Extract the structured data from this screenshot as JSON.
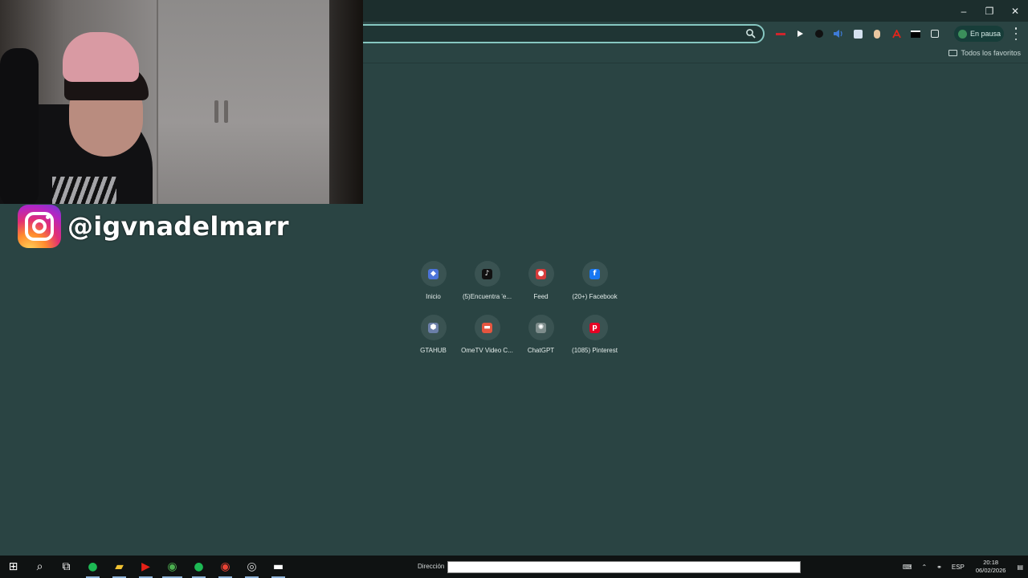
{
  "browser": {
    "window_controls": [
      "–",
      "❐",
      "✕"
    ],
    "extensions": [
      {
        "name": "extension-red-dash",
        "color": "#d0252c"
      },
      {
        "name": "extension-play",
        "color": "#ffffff"
      },
      {
        "name": "extension-dark-circle",
        "color": "#111111"
      },
      {
        "name": "extension-blue-wave",
        "color": "#3e7bd6"
      },
      {
        "name": "extension-translate",
        "color": "#d5e2f0"
      },
      {
        "name": "extension-beige",
        "color": "#e9c6a0"
      },
      {
        "name": "extension-acrobat",
        "color": "#e1251b"
      },
      {
        "name": "extension-badge",
        "color": "#000000"
      },
      {
        "name": "extension-puzzle",
        "color": "#dfe8e7"
      }
    ],
    "profile_status": "En pausa",
    "bookmarks_folder_label": "Todos los favoritos"
  },
  "overlay": {
    "instagram_handle": "@igvnadelmarr"
  },
  "new_tab": {
    "shortcuts": [
      {
        "label": "Inicio",
        "icon": "roblox-icon",
        "color": "#4b73d9",
        "glyph": "◆"
      },
      {
        "label": "(5)Encuentra 'e...",
        "icon": "tiktok-icon",
        "color": "#111111",
        "glyph": "♪"
      },
      {
        "label": "Feed",
        "icon": "feed-icon",
        "color": "#d63b3b",
        "glyph": "●"
      },
      {
        "label": "(20+) Facebook",
        "icon": "facebook-icon",
        "color": "#1877f2",
        "glyph": "f"
      },
      {
        "label": "GTAHUB",
        "icon": "gtahub-icon",
        "color": "#6b7fa8",
        "glyph": "⬢"
      },
      {
        "label": "OmeTV Video C...",
        "icon": "ometv-icon",
        "color": "#e5553f",
        "glyph": "▬"
      },
      {
        "label": "ChatGPT",
        "icon": "chatgpt-icon",
        "color": "#7d8c8b",
        "glyph": "✺"
      },
      {
        "label": "(1085) Pinterest",
        "icon": "pinterest-icon",
        "color": "#e60023",
        "glyph": "p"
      }
    ]
  },
  "taskbar": {
    "address_label": "Dirección",
    "apps": [
      {
        "name": "start-icon",
        "glyph": "⊞",
        "color": "#ffffff"
      },
      {
        "name": "search-icon",
        "glyph": "⌕",
        "color": "#ffffff"
      },
      {
        "name": "task-view-icon",
        "glyph": "⧉",
        "color": "#ffffff"
      },
      {
        "name": "spotify-icon",
        "glyph": "●",
        "color": "#1db954"
      },
      {
        "name": "file-explorer-icon",
        "glyph": "▰",
        "color": "#f1c232"
      },
      {
        "name": "youtube-icon",
        "glyph": "▶",
        "color": "#e62117"
      },
      {
        "name": "chrome-icon",
        "glyph": "◉",
        "color": "#4caf50"
      },
      {
        "name": "spotify-icon-2",
        "glyph": "●",
        "color": "#1db954"
      },
      {
        "name": "chrome-profile-icon",
        "glyph": "◉",
        "color": "#ea4335"
      },
      {
        "name": "obs-icon",
        "glyph": "◎",
        "color": "#d9d9d9"
      },
      {
        "name": "capcut-icon",
        "glyph": "▬",
        "color": "#ffffff"
      }
    ],
    "language": "ESP",
    "time": "20:18",
    "date": "06/02/2026"
  }
}
